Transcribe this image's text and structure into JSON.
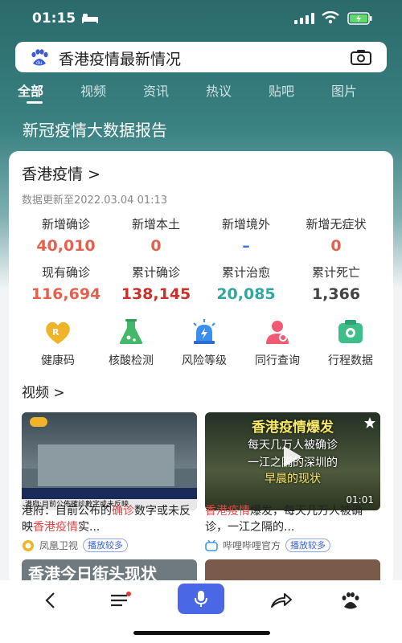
{
  "status_bar": {
    "time": "01:15"
  },
  "search": {
    "query": "香港疫情最新情况"
  },
  "tabs": [
    "全部",
    "视频",
    "资讯",
    "热议",
    "贴吧",
    "图片"
  ],
  "report_title": "新冠疫情大数据报告",
  "card": {
    "region": "香港疫情 >",
    "updated": "数据更新至2022.03.04 01:13",
    "stats_row1": [
      {
        "label": "新增确诊",
        "value": "40,010",
        "color": "#e5614d"
      },
      {
        "label": "新增本土",
        "value": "0",
        "color": "#e5614d"
      },
      {
        "label": "新增境外",
        "value": "–",
        "color": "#3c6ed6"
      },
      {
        "label": "新增无症状",
        "value": "0",
        "color": "#e5614d"
      }
    ],
    "stats_row2": [
      {
        "label": "现有确诊",
        "value": "116,694",
        "color": "#e5614d"
      },
      {
        "label": "累计确诊",
        "value": "138,145",
        "color": "#c8322b"
      },
      {
        "label": "累计治愈",
        "value": "20,085",
        "color": "#32a6a0"
      },
      {
        "label": "累计死亡",
        "value": "1,366",
        "color": "#444444"
      }
    ],
    "features": [
      {
        "label": "健康码",
        "icon": "health-code-icon"
      },
      {
        "label": "核酸检测",
        "icon": "flask-icon"
      },
      {
        "label": "风险等级",
        "icon": "alarm-light-icon"
      },
      {
        "label": "同行查询",
        "icon": "travel-companion-icon"
      },
      {
        "label": "行程数据",
        "icon": "itinerary-icon"
      }
    ]
  },
  "videos": {
    "heading": "视频 >",
    "items": [
      {
        "title_pre": "港府：目前公布的",
        "title_hl1": "确诊",
        "title_mid": "数字或未反映",
        "title_hl2": "香港疫情",
        "title_post": "实...",
        "source": "凤凰卫视",
        "badge": "播放较多",
        "thumb_caption": "港府:目前公佈確診數字或未反映"
      },
      {
        "title_hl1": "香港疫情",
        "title_post": "爆发，每天几万人被确诊，一江之隔的...",
        "source": "哔哩哔哩官方",
        "badge": "播放较多",
        "duration": "01:01",
        "overlay_line1": "香港疫情爆发",
        "overlay_line2": "每天几万人被确诊",
        "overlay_line3": "一江之隔的深圳的",
        "overlay_line4": "早晨的现状"
      }
    ],
    "peek_text": "香港今日街头现状"
  },
  "bottom_bar": [
    "back-icon",
    "menu-icon",
    "mic-icon",
    "share-icon",
    "baidu-paw-icon"
  ]
}
